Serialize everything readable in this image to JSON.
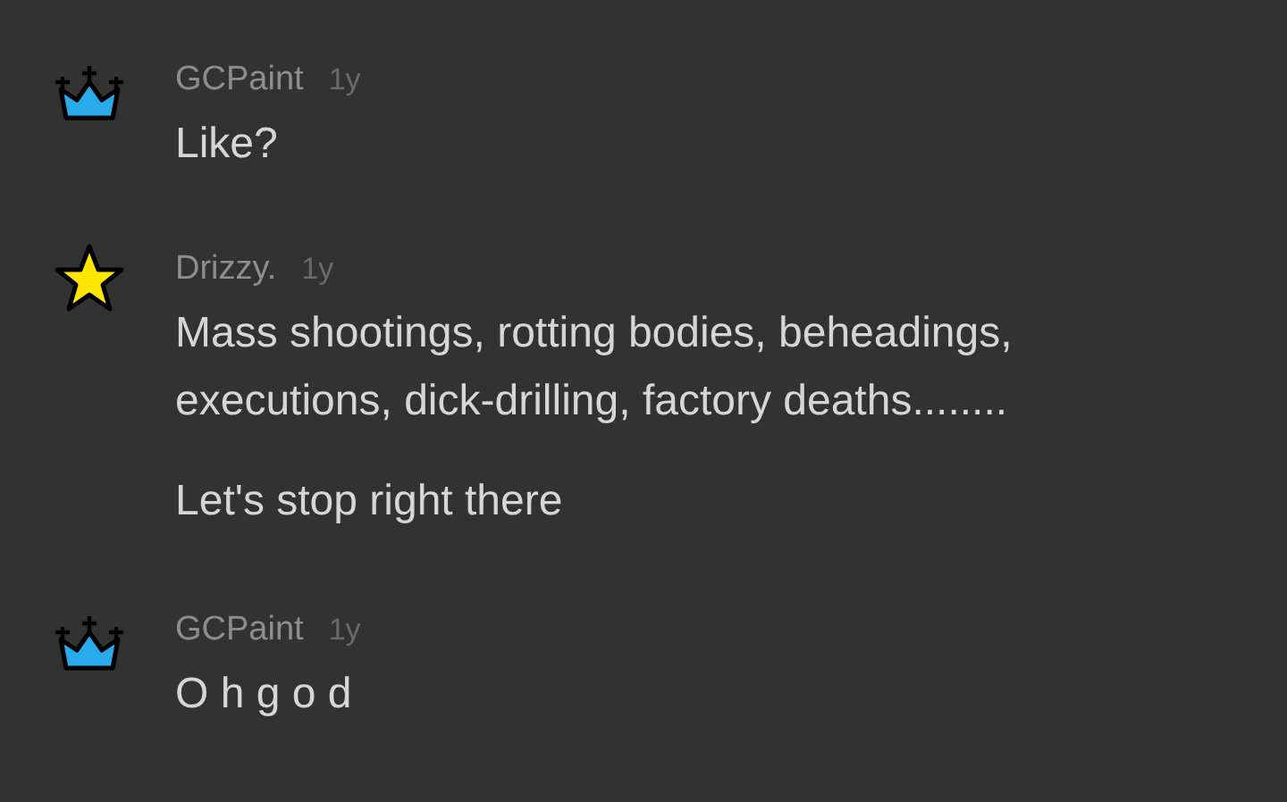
{
  "comments": [
    {
      "kind": "crown",
      "author": "GCPaint",
      "time": "1y",
      "paragraphs": [
        "Like?"
      ]
    },
    {
      "kind": "star",
      "author": "Drizzy.",
      "time": "1y",
      "paragraphs": [
        "Mass shootings, rotting bodies, beheadings, executions, dick-drilling, factory deaths........",
        "Let's stop right there"
      ]
    },
    {
      "kind": "crown",
      "author": "GCPaint",
      "time": "1y",
      "paragraphs": [
        "O h g o d"
      ]
    }
  ]
}
